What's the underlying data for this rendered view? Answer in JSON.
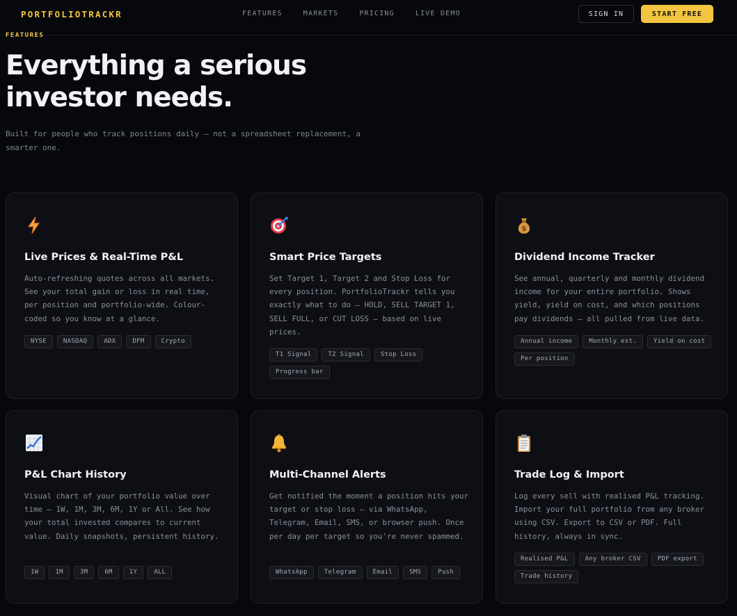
{
  "nav": {
    "logo": "PORTFOLIOTRACKR",
    "links": [
      "FEATURES",
      "MARKETS",
      "PRICING",
      "LIVE DEMO"
    ],
    "sign_in": "SIGN IN",
    "start_free": "START FREE"
  },
  "hero": {
    "eyebrow": "FEATURES",
    "headline_line1": "Everything a serious",
    "headline_line2": "investor needs.",
    "subtitle": "Built for people who track positions daily — not a spreadsheet replacement, a smarter one."
  },
  "features": [
    {
      "icon": "lightning-icon",
      "title": "Live Prices & Real-Time P&L",
      "description": "Auto-refreshing quotes across all markets. See your total gain or loss in real time, per position and portfolio-wide. Colour-coded so you know at a glance.",
      "tags": [
        "NYSE",
        "NASDAQ",
        "ADX",
        "DFM",
        "Crypto"
      ]
    },
    {
      "icon": "target-icon",
      "title": "Smart Price Targets",
      "description": "Set Target 1, Target 2 and Stop Loss for every position. PortfolioTrackr tells you exactly what to do — HOLD, SELL TARGET 1, SELL FULL, or CUT LOSS — based on live prices.",
      "tags": [
        "T1 Signal",
        "T2 Signal",
        "Stop Loss",
        "Progress bar"
      ]
    },
    {
      "icon": "money-bag-icon",
      "title": "Dividend Income Tracker",
      "description": "See annual, quarterly and monthly dividend income for your entire portfolio. Shows yield, yield on cost, and which positions pay dividends — all pulled from live data.",
      "tags": [
        "Annual income",
        "Monthly est.",
        "Yield on cost",
        "Per position"
      ]
    },
    {
      "icon": "chart-icon",
      "title": "P&L Chart History",
      "description": "Visual chart of your portfolio value over time — 1W, 1M, 3M, 6M, 1Y or All. See how your total invested compares to current value. Daily snapshots, persistent history.",
      "tags": [
        "1W",
        "1M",
        "3M",
        "6M",
        "1Y",
        "ALL"
      ]
    },
    {
      "icon": "bell-icon",
      "title": "Multi-Channel Alerts",
      "description": "Get notified the moment a position hits your target or stop loss — via WhatsApp, Telegram, Email, SMS, or browser push. Once per day per target so you're never spammed.",
      "tags": [
        "WhatsApp",
        "Telegram",
        "Email",
        "SMS",
        "Push"
      ]
    },
    {
      "icon": "clipboard-icon",
      "title": "Trade Log & Import",
      "description": "Log every sell with realised P&L tracking. Import your full portfolio from any broker using CSV. Export to CSV or PDF. Full history, always in sync.",
      "tags": [
        "Realised P&L",
        "Any broker CSV",
        "PDF export",
        "Trade history"
      ]
    }
  ],
  "colors": {
    "background": "#07080b",
    "accent": "#f3c540",
    "card": "#0e0f14",
    "text": "#f1f2f5",
    "muted": "#8a8f9b"
  }
}
